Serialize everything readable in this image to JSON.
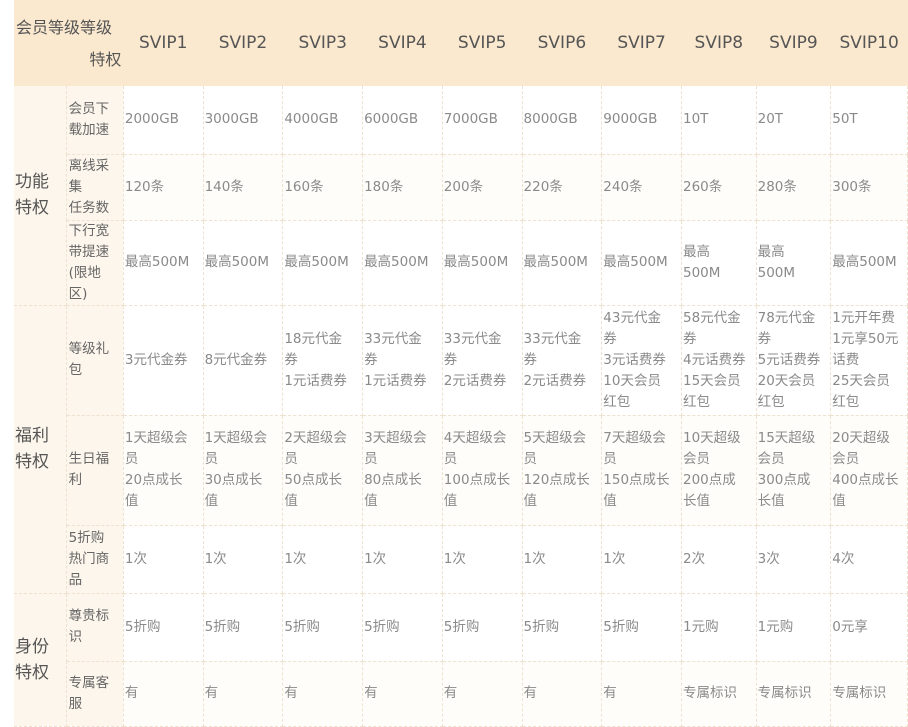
{
  "header": {
    "corner_top": "会员等级等级",
    "corner_bottom": "特权",
    "levels": [
      "SVIP1",
      "SVIP2",
      "SVIP3",
      "SVIP4",
      "SVIP5",
      "SVIP6",
      "SVIP7",
      "SVIP8",
      "SVIP9",
      "SVIP10"
    ]
  },
  "categories": [
    {
      "name": [
        "功能",
        "特权"
      ],
      "rows": [
        {
          "label": [
            "会员下",
            "载加速"
          ],
          "cells": [
            [
              "2000GB"
            ],
            [
              "3000GB"
            ],
            [
              "4000GB"
            ],
            [
              "6000GB"
            ],
            [
              "7000GB"
            ],
            [
              "8000GB"
            ],
            [
              "9000GB"
            ],
            [
              "10T"
            ],
            [
              "20T"
            ],
            [
              "50T"
            ]
          ]
        },
        {
          "label": [
            "离线采",
            "集",
            "任务数"
          ],
          "cells": [
            [
              "120条"
            ],
            [
              "140条"
            ],
            [
              "160条"
            ],
            [
              "180条"
            ],
            [
              "200条"
            ],
            [
              "220条"
            ],
            [
              "240条"
            ],
            [
              "260条"
            ],
            [
              "280条"
            ],
            [
              "300条"
            ]
          ]
        },
        {
          "label": [
            "下行宽",
            "带提速",
            "(限地",
            "区)"
          ],
          "cells": [
            [
              "最高500M"
            ],
            [
              "最高500M"
            ],
            [
              "最高500M"
            ],
            [
              "最高500M"
            ],
            [
              "最高500M"
            ],
            [
              "最高500M"
            ],
            [
              "最高500M"
            ],
            [
              "最高",
              "500M"
            ],
            [
              "最高",
              "500M"
            ],
            [
              "最高500M"
            ]
          ]
        }
      ]
    },
    {
      "name": [
        "福利",
        "特权"
      ],
      "rows": [
        {
          "label": [
            "等级礼",
            "包"
          ],
          "cells": [
            [
              "3元代金券"
            ],
            [
              "8元代金券"
            ],
            [
              "18元代金",
              "券",
              "1元话费券"
            ],
            [
              "33元代金",
              "券",
              "1元话费券"
            ],
            [
              "33元代金",
              "券",
              "2元话费券"
            ],
            [
              "33元代金",
              "券",
              "2元话费券"
            ],
            [
              "43元代金",
              "券",
              "3元话费券",
              "10天会员",
              "红包"
            ],
            [
              "58元代金",
              "券",
              "4元话费券",
              "15天会员",
              "红包"
            ],
            [
              "78元代金",
              "券",
              "5元话费券",
              "20天会员",
              "红包"
            ],
            [
              "1元开年费",
              "1元享50元",
              "话费",
              "25天会员",
              "红包"
            ]
          ]
        },
        {
          "label": [
            "生日福",
            "利"
          ],
          "cells": [
            [
              "1天超级会",
              "员",
              "20点成长",
              "值"
            ],
            [
              "1天超级会",
              "员",
              "30点成长",
              "值"
            ],
            [
              "2天超级会",
              "员",
              "50点成长",
              "值"
            ],
            [
              "3天超级会",
              "员",
              "80点成长",
              "值"
            ],
            [
              "4天超级会",
              "员",
              "100点成长",
              "值"
            ],
            [
              "5天超级会",
              "员",
              "120点成长",
              "值"
            ],
            [
              "7天超级会",
              "员",
              "150点成长",
              "值"
            ],
            [
              "10天超级",
              "会员",
              "200点成",
              "长值"
            ],
            [
              "15天超级",
              "会员",
              "300点成",
              "长值"
            ],
            [
              "20天超级",
              "会员",
              "400点成长",
              "值"
            ]
          ]
        },
        {
          "label": [
            "5折购",
            "热门商",
            "品"
          ],
          "cells": [
            [
              "1次"
            ],
            [
              "1次"
            ],
            [
              "1次"
            ],
            [
              "1次"
            ],
            [
              "1次"
            ],
            [
              "1次"
            ],
            [
              "1次"
            ],
            [
              "2次"
            ],
            [
              "3次"
            ],
            [
              "4次"
            ]
          ]
        }
      ]
    },
    {
      "name": [
        "身份",
        "特权"
      ],
      "rows": [
        {
          "label": [
            "尊贵标",
            "识"
          ],
          "cells": [
            [
              "5折购"
            ],
            [
              "5折购"
            ],
            [
              "5折购"
            ],
            [
              "5折购"
            ],
            [
              "5折购"
            ],
            [
              "5折购"
            ],
            [
              "5折购"
            ],
            [
              "1元购"
            ],
            [
              "1元购"
            ],
            [
              "0元享"
            ]
          ]
        },
        {
          "label": [
            "专属客",
            "服"
          ],
          "cells": [
            [
              "有"
            ],
            [
              "有"
            ],
            [
              "有"
            ],
            [
              "有"
            ],
            [
              "有"
            ],
            [
              "有"
            ],
            [
              "有"
            ],
            [
              "专属标识"
            ],
            [
              "专属标识"
            ],
            [
              "专属标识"
            ]
          ]
        }
      ]
    }
  ]
}
